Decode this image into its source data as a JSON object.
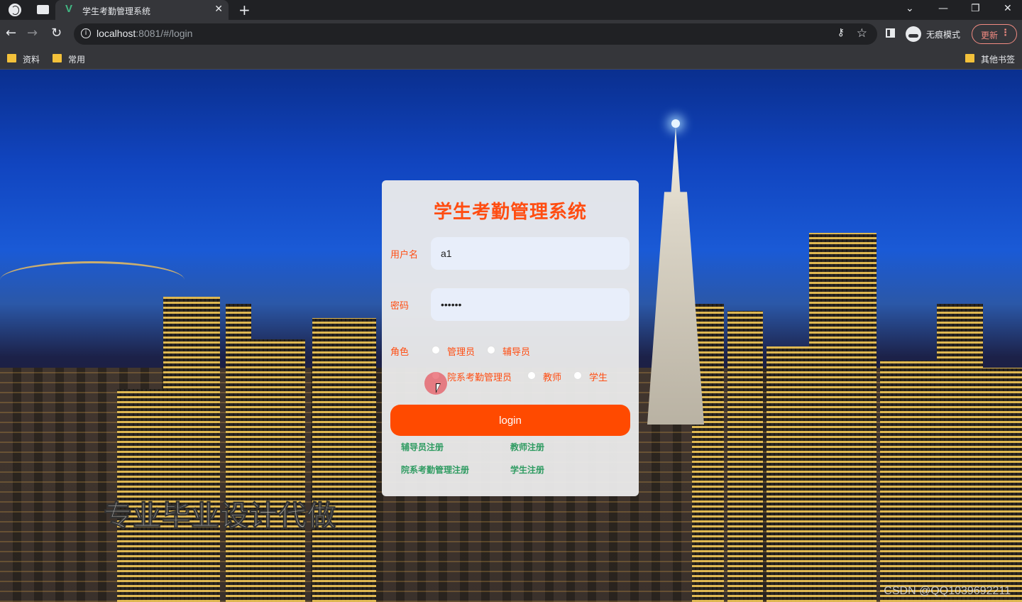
{
  "browser": {
    "tab_title": "学生考勤管理系统",
    "tab_favicon": "V",
    "tab_close": "✕",
    "new_tab": "+",
    "url_host": "localhost",
    "url_rest": ":8081/#/login",
    "incognito_label": "无痕模式",
    "update_label": "更新",
    "bookmarks": [
      {
        "label": "资料"
      },
      {
        "label": "常用"
      }
    ],
    "other_bookmarks": "其他书签",
    "icons": [
      "globe-icon",
      "tab-list-icon",
      "back-icon",
      "forward-icon",
      "reload-icon",
      "info-icon",
      "key-icon",
      "star-icon",
      "side-panel-icon",
      "incognito-icon",
      "menu-icon",
      "folder-icon",
      "minimize-icon",
      "restore-icon",
      "close-window-icon",
      "chevron-down-icon"
    ]
  },
  "login": {
    "title": "学生考勤管理系统",
    "username_label": "用户名",
    "username_value": "a1",
    "password_label": "密码",
    "password_value": "123456",
    "role_label": "角色",
    "roles": [
      "管理员",
      "辅导员",
      "院系考勤管理员",
      "教师",
      "学生"
    ],
    "login_button": "login",
    "register_links": [
      "辅导员注册",
      "教师注册",
      "院系考勤管理注册",
      "学生注册"
    ]
  },
  "overlay": {
    "watermark": "专业毕业设计代做",
    "source": "CSDN @QQ1039692211"
  },
  "colors": {
    "accent": "#ff4d12",
    "button": "#ff4a00",
    "link": "#2e9b61"
  }
}
